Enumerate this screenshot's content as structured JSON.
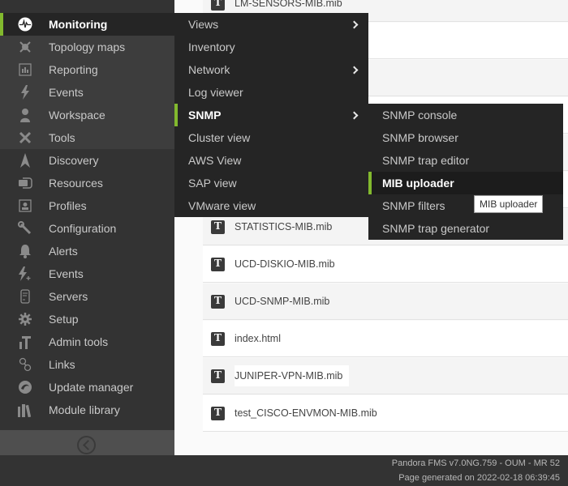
{
  "sidebar": {
    "items": [
      {
        "label": "Monitoring",
        "icon": "monitoring-icon",
        "active": true
      },
      {
        "label": "Topology maps",
        "icon": "topology-icon"
      },
      {
        "label": "Reporting",
        "icon": "reporting-icon"
      },
      {
        "label": "Events",
        "icon": "events-icon"
      },
      {
        "label": "Workspace",
        "icon": "workspace-icon"
      },
      {
        "label": "Tools",
        "icon": "tools-icon"
      },
      {
        "label": "Discovery",
        "icon": "discovery-icon"
      },
      {
        "label": "Resources",
        "icon": "resources-icon"
      },
      {
        "label": "Profiles",
        "icon": "profiles-icon"
      },
      {
        "label": "Configuration",
        "icon": "wrench-icon"
      },
      {
        "label": "Alerts",
        "icon": "bell-icon"
      },
      {
        "label": "Events",
        "icon": "events-plus-icon"
      },
      {
        "label": "Servers",
        "icon": "servers-icon"
      },
      {
        "label": "Setup",
        "icon": "gear-icon"
      },
      {
        "label": "Admin tools",
        "icon": "admin-tools-icon"
      },
      {
        "label": "Links",
        "icon": "links-icon"
      },
      {
        "label": "Update manager",
        "icon": "update-manager-icon"
      },
      {
        "label": "Module library",
        "icon": "module-library-icon"
      }
    ],
    "collapse_icon": "collapse-left-icon"
  },
  "monitoring_menu": {
    "items": [
      {
        "label": "Views",
        "has_submenu": true
      },
      {
        "label": "Inventory",
        "has_submenu": false
      },
      {
        "label": "Network",
        "has_submenu": true
      },
      {
        "label": "Log viewer",
        "has_submenu": false
      },
      {
        "label": "SNMP",
        "has_submenu": true,
        "selected": true
      },
      {
        "label": "Cluster view",
        "has_submenu": false
      },
      {
        "label": "AWS View",
        "has_submenu": false
      },
      {
        "label": "SAP view",
        "has_submenu": false
      },
      {
        "label": "VMware view",
        "has_submenu": false
      }
    ]
  },
  "snmp_menu": {
    "items": [
      {
        "label": "SNMP console"
      },
      {
        "label": "SNMP browser"
      },
      {
        "label": "SNMP trap editor"
      },
      {
        "label": "MIB uploader",
        "selected": true
      },
      {
        "label": "SNMP filters"
      },
      {
        "label": "SNMP trap generator"
      }
    ]
  },
  "tooltip": {
    "text": "MIB uploader"
  },
  "files": [
    {
      "name": "LM-SENSORS-MIB.mib"
    },
    {
      "name": ""
    },
    {
      "name": ""
    },
    {
      "name": ""
    },
    {
      "name": ""
    },
    {
      "name": ""
    },
    {
      "name": "STATISTICS-MIB.mib"
    },
    {
      "name": "UCD-DISKIO-MIB.mib"
    },
    {
      "name": "UCD-SNMP-MIB.mib"
    },
    {
      "name": "index.html"
    },
    {
      "name": "JUNIPER-VPN-MIB.mib"
    },
    {
      "name": "test_CISCO-ENVMON-MIB.mib"
    }
  ],
  "file_icon_glyph": "T",
  "footer": {
    "version": "Pandora FMS v7.0NG.759 - OUM - MR 52",
    "generated": "Page generated on 2022-02-18 06:39:45"
  },
  "colors": {
    "accent": "#82b92e",
    "sidebar_bg": "#333333",
    "menu_bg": "#252525"
  }
}
